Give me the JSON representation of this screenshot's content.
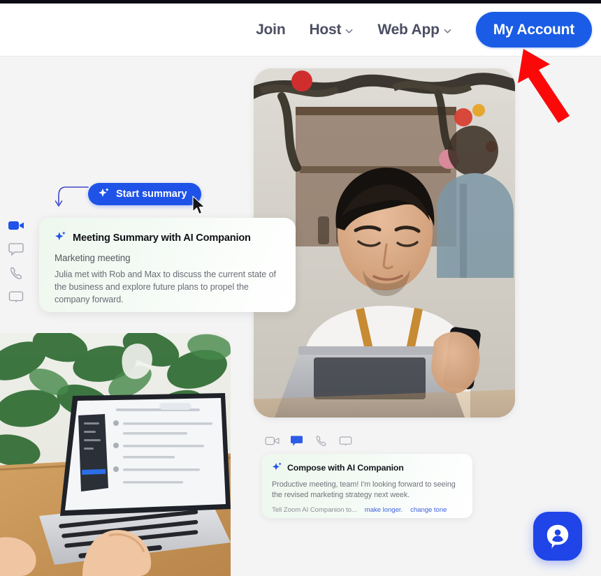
{
  "page": {
    "title": "Zoom AI Companion marketing page",
    "background_color": "#f4f4f5",
    "accent_color": "#1a5ce5",
    "annotation_arrow_color": "#fb0909"
  },
  "nav": {
    "items": [
      {
        "label": "Join",
        "has_dropdown": false,
        "icon": ""
      },
      {
        "label": "Host",
        "has_dropdown": true,
        "icon": "chevron-down-icon"
      },
      {
        "label": "Web App",
        "has_dropdown": true,
        "icon": "chevron-down-icon"
      }
    ],
    "account_button": {
      "label": "My Account",
      "color": "#1a5ce5",
      "text_color": "#ffffff"
    }
  },
  "annotation": {
    "arrow": {
      "name": "red-pointer-arrow",
      "color": "#fb0909",
      "points_to": "My Account"
    }
  },
  "left_rail": {
    "items": [
      {
        "name": "video-icon",
        "active": true
      },
      {
        "name": "chat-bubble-icon",
        "active": false
      },
      {
        "name": "phone-icon",
        "active": false
      },
      {
        "name": "whiteboard-icon",
        "active": false
      }
    ]
  },
  "hero": {
    "photo_alt": "Shop owner in apron using a laptop and phone at a counter",
    "start_summary_button": {
      "label": "Start summary",
      "icon": "sparkle-icon",
      "color": "#1f53e8"
    },
    "cursor": {
      "name": "mouse-cursor-icon"
    },
    "curve_arrow": {
      "name": "curved-down-arrow-icon",
      "color": "#4146c7"
    }
  },
  "summary_card": {
    "icon": "sparkle-icon",
    "title": "Meeting Summary with AI Companion",
    "subtitle": "Marketing meeting",
    "body": "Julia met with Rob and Max to discuss the current state of the business and explore future plans to propel the company forward."
  },
  "laptop_photo": {
    "alt": "Hands typing on a MacBook laptop at a wooden desk with a plant behind"
  },
  "icon_row": {
    "items": [
      {
        "name": "video-icon",
        "active": false
      },
      {
        "name": "chat-bubble-icon",
        "active": true
      },
      {
        "name": "phone-icon",
        "active": false
      },
      {
        "name": "whiteboard-icon",
        "active": false
      }
    ]
  },
  "compose_card": {
    "icon": "sparkle-icon",
    "title": "Compose with AI Companion",
    "body": "Productive meeting, team! I'm looking forward to seeing the revised marketing strategy next week.",
    "prompt_label": "Tell Zoom AI Companion to...",
    "actions": [
      {
        "label": "make longer."
      },
      {
        "label": "change tone"
      }
    ]
  },
  "support_fab": {
    "name": "support-chat-button",
    "icon": "person-in-speech-bubble-icon",
    "color": "#1f44e8"
  }
}
